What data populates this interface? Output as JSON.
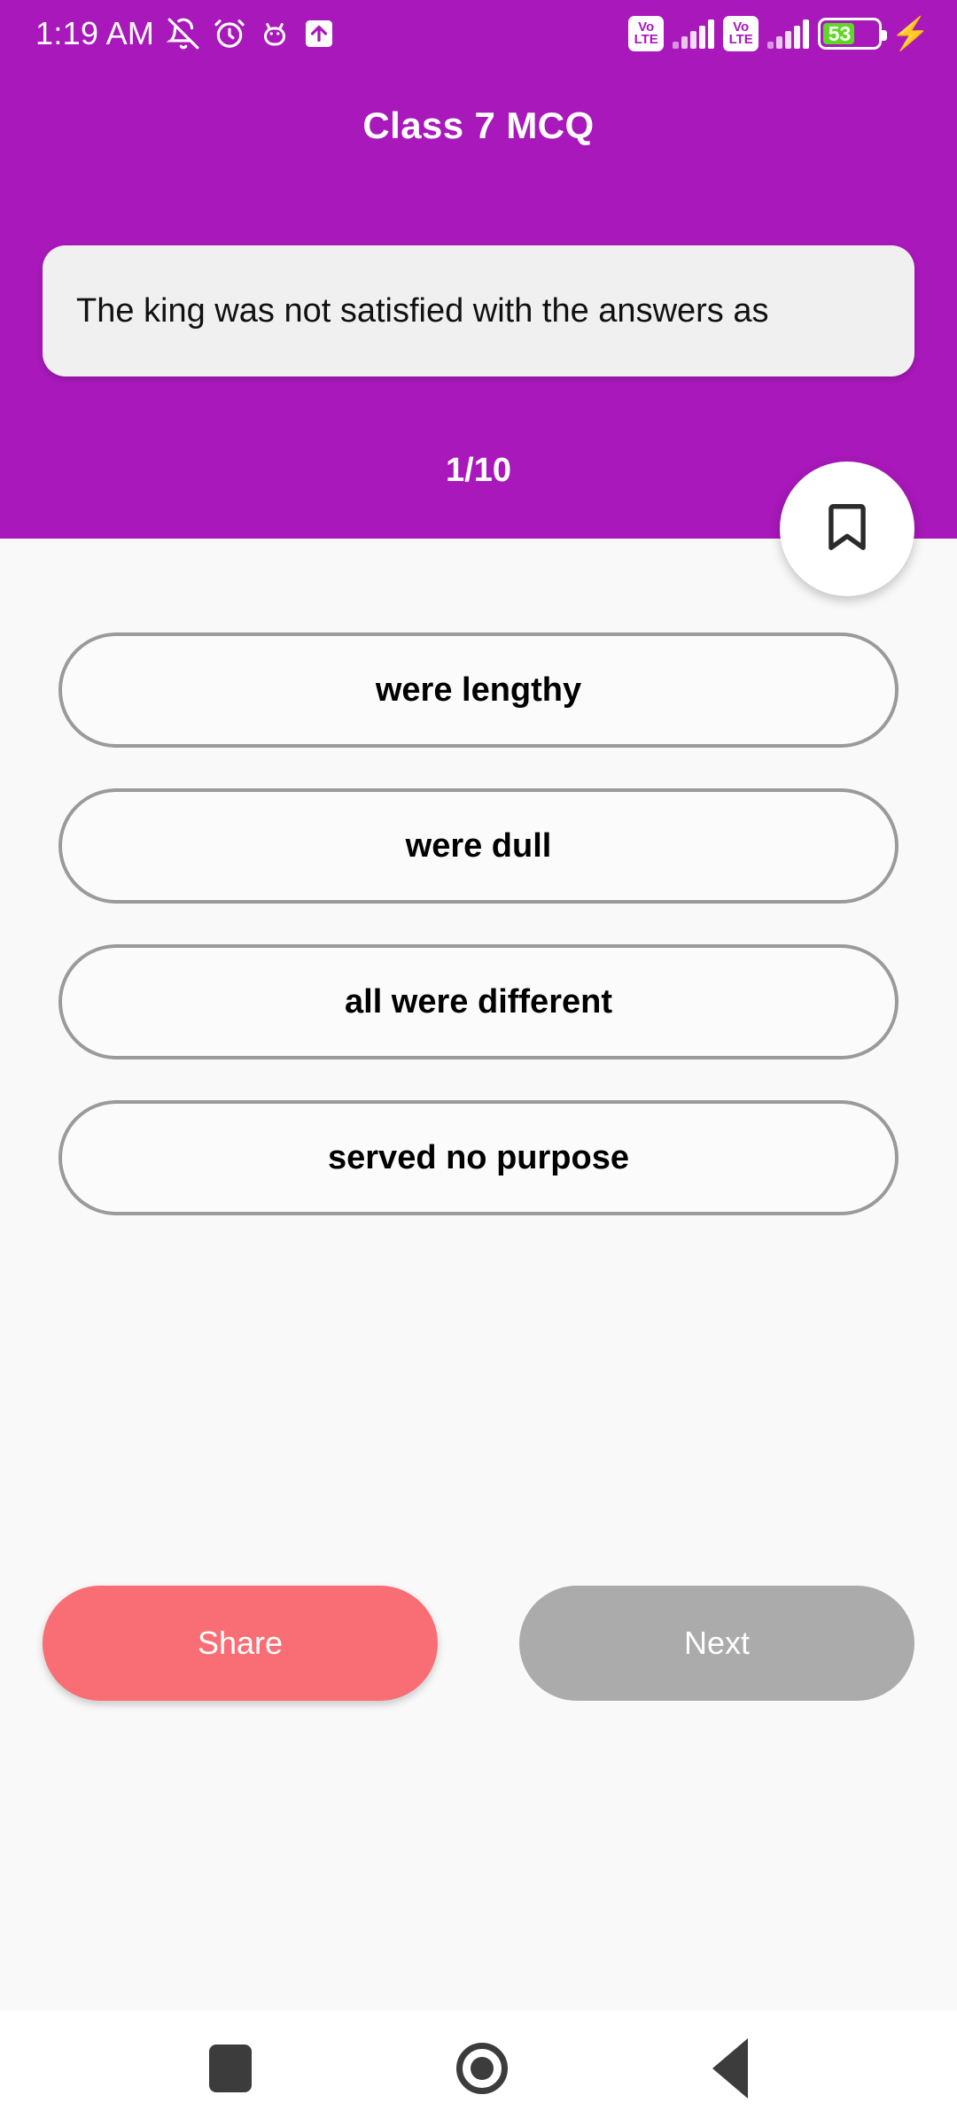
{
  "status_bar": {
    "time": "1:19 AM",
    "left_icons": [
      "bell-off-icon",
      "alarm-clock-icon",
      "android-debug-icon",
      "upload-arrow-icon"
    ],
    "sim1_network": "VoLTE",
    "sim1_label_top": "Vo",
    "sim1_label_bottom": "LTE",
    "sim2_network": "VoLTE",
    "sim2_label_top": "Vo",
    "sim2_label_bottom": "LTE",
    "signal_bars": 5,
    "battery_percent": "53",
    "battery_charging": true,
    "charging_icon": "lightning-bolt-icon"
  },
  "header": {
    "title": "Class 7 MCQ",
    "background_color": "#A818BA",
    "question": "The king was not satisfied with the answers as",
    "counter": "1/10",
    "bookmark_icon": "bookmark-icon"
  },
  "options": [
    {
      "label": "were lengthy"
    },
    {
      "label": "were dull"
    },
    {
      "label": "all were different"
    },
    {
      "label": "served no purpose"
    }
  ],
  "actions": {
    "share_label": "Share",
    "share_color": "#F96E74",
    "next_label": "Next",
    "next_color": "#ABABAB"
  },
  "nav_bar": {
    "recents": "recents-square-icon",
    "home": "home-circle-icon",
    "back": "back-triangle-icon"
  }
}
